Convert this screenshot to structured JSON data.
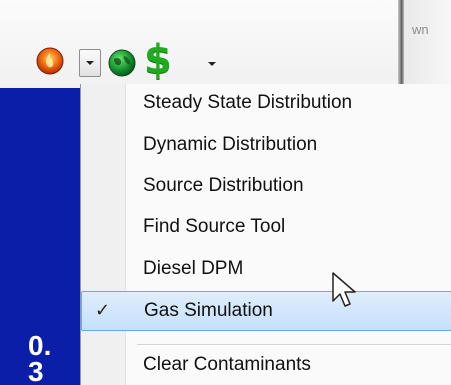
{
  "toolbar": {
    "right_text": "wn",
    "icons": {
      "fire": "flame-icon",
      "dropdown": "chevron-down-icon",
      "globe": "globe-icon",
      "dollar": "$"
    }
  },
  "panel": {
    "line1": "0.",
    "line2": "3"
  },
  "menu": {
    "items": [
      {
        "label": "Steady State Distribution"
      },
      {
        "label": "Dynamic Distribution"
      },
      {
        "label": "Source Distribution"
      },
      {
        "label": "Find Source Tool"
      },
      {
        "label": "Diesel DPM"
      },
      {
        "label": "Gas Simulation",
        "checked": true,
        "check_mark": "✓"
      },
      {
        "label": "Clear Contaminants"
      }
    ]
  },
  "colors": {
    "panel_blue": "#0a1ea8",
    "highlight_fill": "#c6e0fb",
    "highlight_border": "#6fa8e7",
    "dollar_green": "#1faa1f"
  }
}
